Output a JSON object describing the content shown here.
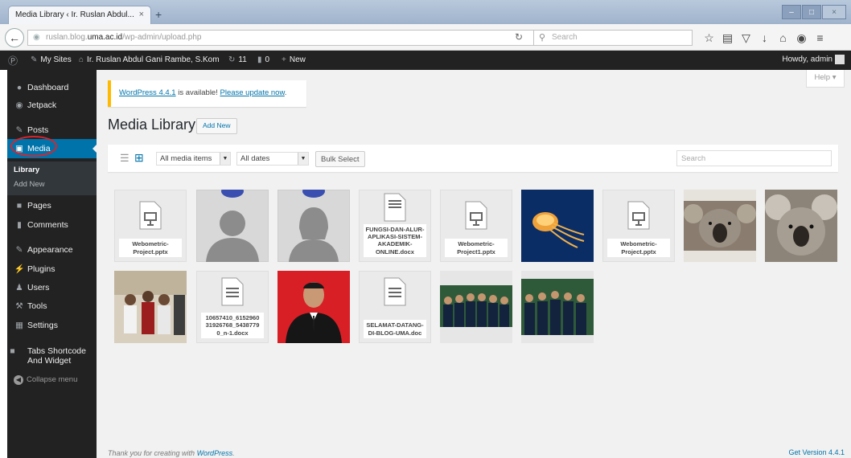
{
  "browser": {
    "tab_title": "Media Library ‹ Ir. Ruslan Abdul...",
    "tab_close": "×",
    "new_tab": "+",
    "url_prefix": "ruslan.blog.",
    "url_domain": "uma.ac.id",
    "url_path": "/wp-admin/upload.php",
    "search_placeholder": "Search",
    "window_controls": [
      "–",
      "□",
      "×"
    ],
    "toolbar_icons": [
      "star-icon",
      "reading-list-icon",
      "pocket-icon",
      "download-icon",
      "home-icon",
      "chat-icon",
      "menu-icon"
    ]
  },
  "admin_bar": {
    "my_sites": "My Sites",
    "site_name": "Ir. Ruslan Abdul Gani Rambe, S.Kom",
    "updates_count": "11",
    "comments_count": "0",
    "new_label": "New",
    "howdy": "Howdy, admin"
  },
  "sidebar": {
    "items": [
      {
        "label": "Dashboard",
        "icon": "dashboard-icon"
      },
      {
        "label": "Jetpack",
        "icon": "jetpack-icon"
      },
      {
        "label": "Posts",
        "icon": "pin-icon"
      },
      {
        "label": "Media",
        "icon": "media-icon"
      },
      {
        "label": "Pages",
        "icon": "pages-icon"
      },
      {
        "label": "Comments",
        "icon": "comments-icon"
      },
      {
        "label": "Appearance",
        "icon": "brush-icon"
      },
      {
        "label": "Plugins",
        "icon": "plugin-icon"
      },
      {
        "label": "Users",
        "icon": "users-icon"
      },
      {
        "label": "Tools",
        "icon": "wrench-icon"
      },
      {
        "label": "Settings",
        "icon": "settings-icon"
      },
      {
        "label": "Tabs Shortcode And Widget",
        "icon": "tabs-icon"
      }
    ],
    "submenu": {
      "library": "Library",
      "add_new": "Add New"
    },
    "collapse": "Collapse menu"
  },
  "main": {
    "help": "Help ▾",
    "notice": {
      "version_link": "WordPress 4.4.1",
      "text": " is available! ",
      "update_link": "Please update now",
      "end": "."
    },
    "title": "Media Library",
    "add_new": "Add New",
    "filters": {
      "media_type": "All media items",
      "dates": "All dates",
      "bulk_select": "Bulk Select",
      "search_placeholder": "Search"
    },
    "attachments": [
      {
        "type": "document",
        "filename": "Webometric-Project.pptx"
      },
      {
        "type": "image",
        "subject": "avatar-male"
      },
      {
        "type": "image",
        "subject": "avatar-female"
      },
      {
        "type": "document",
        "filename": "FUNGSI-DAN-ALUR-APLIKASI-SISTEM-AKADEMIK-ONLINE.docx"
      },
      {
        "type": "document",
        "filename": "Webometric-Project1.pptx"
      },
      {
        "type": "image",
        "subject": "jellyfish"
      },
      {
        "type": "document",
        "filename": "Webometric-Project.pptx"
      },
      {
        "type": "image",
        "subject": "koala"
      },
      {
        "type": "image",
        "subject": "koala"
      },
      {
        "type": "image",
        "subject": "group-photo"
      },
      {
        "type": "document",
        "filename": "10657410_6152960 31926768_5438779 0_n-1.docx"
      },
      {
        "type": "image",
        "subject": "portrait-red-background"
      },
      {
        "type": "document",
        "filename": "SELAMAT-DATANG-DI-BLOG-UMA.doc"
      },
      {
        "type": "image",
        "subject": "group-uniform"
      },
      {
        "type": "image",
        "subject": "group-uniform"
      }
    ]
  },
  "footer": {
    "thanks_prefix": "Thank you for creating with ",
    "wordpress": "WordPress",
    "thanks_suffix": ".",
    "version": "Get Version 4.4.1"
  },
  "colors": {
    "admin_bar": "#222222",
    "active_menu": "#0073aa",
    "notice_border": "#ffba00",
    "link": "#0073aa",
    "annotation": "#d9242c"
  }
}
